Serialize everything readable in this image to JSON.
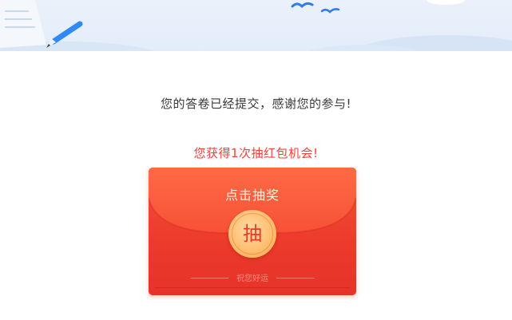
{
  "header": {
    "illustration": "survey-banner",
    "icons": [
      "pen-icon",
      "bird-icon",
      "bird-icon"
    ]
  },
  "messages": {
    "submitted": "您的答卷已经提交，感谢您的参与!",
    "lottery_chance": "您获得1次抽红包机会!"
  },
  "envelope": {
    "title": "点击抽奖",
    "coin_label": "抽",
    "blessing": "祝您好运"
  },
  "colors": {
    "accent_red": "#f0423a",
    "envelope_red": "#ec3a2b",
    "coin_gold": "#ffbf72",
    "banner_blue": "#e3edf9"
  }
}
